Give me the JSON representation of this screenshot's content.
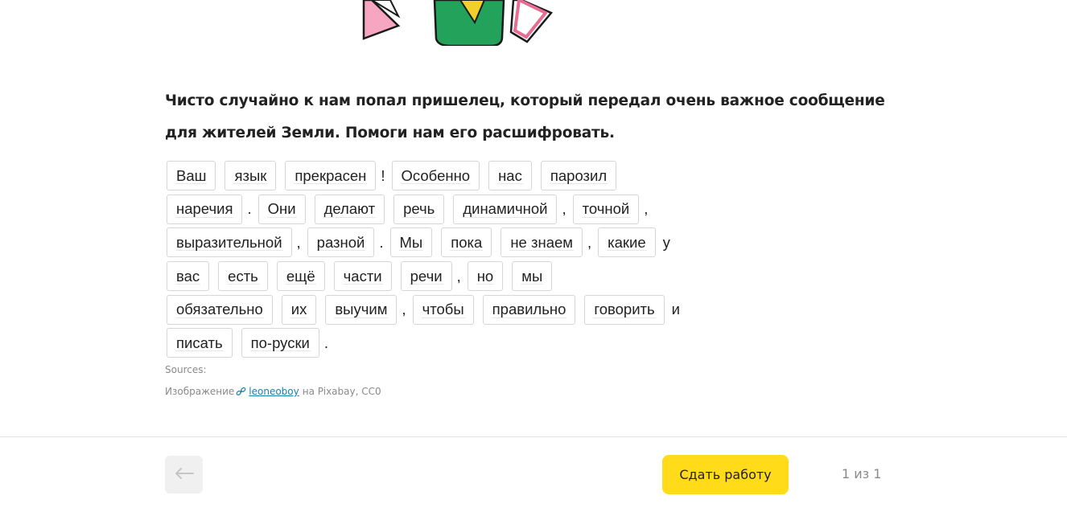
{
  "illustration": {
    "icon": "alien-illustration"
  },
  "task": {
    "text": "Чисто случайно к нам попал пришелец, который передал очень важное сообщение для жителей Земли. Помоги нам его расшифровать."
  },
  "puzzle": {
    "lines": [
      [
        {
          "t": "w",
          "v": "Ваш"
        },
        {
          "t": "w",
          "v": "язык"
        },
        {
          "t": "w",
          "v": "прекрасен"
        },
        {
          "t": "p",
          "v": "!"
        },
        {
          "t": "w",
          "v": "Особенно"
        },
        {
          "t": "w",
          "v": "нас"
        },
        {
          "t": "w",
          "v": "парозил"
        }
      ],
      [
        {
          "t": "w",
          "v": "наречия"
        },
        {
          "t": "p",
          "v": "."
        },
        {
          "t": "w",
          "v": "Они"
        },
        {
          "t": "w",
          "v": "делают"
        },
        {
          "t": "w",
          "v": "речь"
        },
        {
          "t": "w",
          "v": "динамичной"
        },
        {
          "t": "p",
          "v": ","
        },
        {
          "t": "w",
          "v": "точной"
        },
        {
          "t": "p",
          "v": ","
        }
      ],
      [
        {
          "t": "w",
          "v": "выразительной"
        },
        {
          "t": "p",
          "v": ","
        },
        {
          "t": "w",
          "v": "разной"
        },
        {
          "t": "p",
          "v": "."
        },
        {
          "t": "w",
          "v": "Мы"
        },
        {
          "t": "w",
          "v": "пока"
        },
        {
          "t": "w",
          "v": "не знаем"
        },
        {
          "t": "p",
          "v": ","
        },
        {
          "t": "w",
          "v": "какие"
        },
        {
          "t": "p",
          "v": "у"
        }
      ],
      [
        {
          "t": "w",
          "v": "вас"
        },
        {
          "t": "w",
          "v": "есть"
        },
        {
          "t": "w",
          "v": "ещё"
        },
        {
          "t": "w",
          "v": "части"
        },
        {
          "t": "w",
          "v": "речи"
        },
        {
          "t": "p",
          "v": ","
        },
        {
          "t": "w",
          "v": "но"
        },
        {
          "t": "w",
          "v": "мы"
        }
      ],
      [
        {
          "t": "w",
          "v": "обязательно"
        },
        {
          "t": "w",
          "v": "их"
        },
        {
          "t": "w",
          "v": "выучим"
        },
        {
          "t": "p",
          "v": ","
        },
        {
          "t": "w",
          "v": "чтобы"
        },
        {
          "t": "w",
          "v": "правильно"
        },
        {
          "t": "w",
          "v": "говорить"
        },
        {
          "t": "p",
          "v": "и"
        }
      ],
      [
        {
          "t": "w",
          "v": "писать"
        },
        {
          "t": "w",
          "v": "по-руски"
        },
        {
          "t": "p",
          "v": "."
        }
      ]
    ]
  },
  "sources": {
    "label": "Sources:",
    "prefix": "Изображение",
    "link_icon": "link-icon",
    "author": "leoneoboy",
    "suffix": "на Pixabay, CC0"
  },
  "footer": {
    "back_icon": "arrow-left-icon",
    "submit_label": "Сдать работу",
    "pager": "1 из 1"
  },
  "colors": {
    "submit_bg": "#ffdb1a",
    "link": "#1a7fa8",
    "muted": "#8a8a8a",
    "border": "#d6d6d6"
  }
}
